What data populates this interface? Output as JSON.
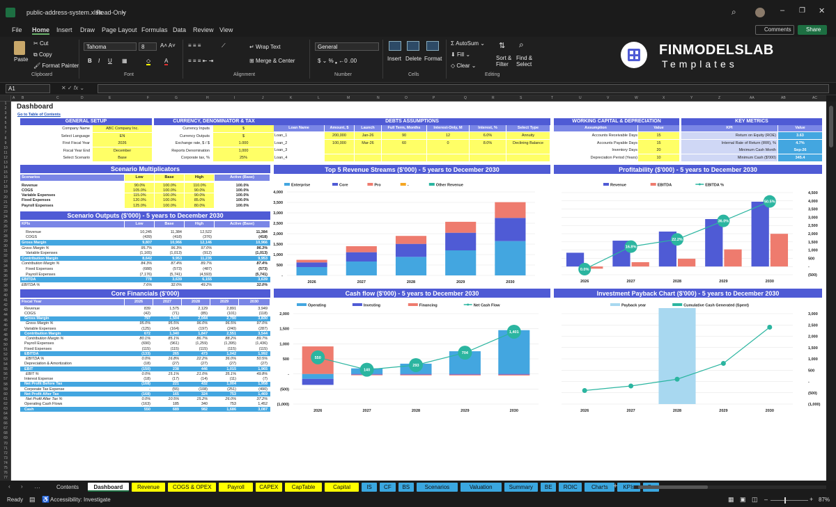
{
  "window": {
    "filename": "public-address-system.xlsx",
    "mode": "Read-Only"
  },
  "menu": [
    "File",
    "Home",
    "Insert",
    "Draw",
    "Page Layout",
    "Formulas",
    "Data",
    "Review",
    "View"
  ],
  "header_buttons": {
    "comments": "Comments",
    "share": "Share"
  },
  "ribbon": {
    "paste": "Paste",
    "cut": "Cut",
    "copy": "Copy",
    "format_painter": "Format Painter",
    "clipboard": "Clipboard",
    "font_name": "Tahoma",
    "font_size": "8",
    "font": "Font",
    "wrap_text": "Wrap Text",
    "merge_center": "Merge & Center",
    "alignment": "Alignment",
    "number_format": "General",
    "number": "Number",
    "insert": "Insert",
    "delete": "Delete",
    "format": "Format",
    "cells": "Cells",
    "autosum": "AutoSum",
    "fill": "Fill",
    "clear": "Clear",
    "sort_filter": "Sort &\nFilter",
    "find_select": "Find &\nSelect",
    "editing": "Editing"
  },
  "brand": {
    "name": "FINMODELSLAB",
    "tagline": "Templates"
  },
  "name_box": "A1",
  "columns": [
    "A",
    "B",
    "C",
    "D",
    "E",
    "F",
    "G",
    "H",
    "I",
    "J",
    "K",
    "L",
    "M",
    "N",
    "O",
    "P",
    "Q",
    "R",
    "S",
    "T",
    "U",
    "V",
    "W",
    "X",
    "Y",
    "Z",
    "AA",
    "AB",
    "AC"
  ],
  "sheet": {
    "title": "Dashboard",
    "toc_link": "Go to Table of Contents",
    "general_setup": {
      "title": "GENERAL SETUP",
      "rows": [
        [
          "Company Name",
          "ABC Company Inc."
        ],
        [
          "Select Language",
          "EN"
        ],
        [
          "First Fiscal Year",
          "2026"
        ],
        [
          "Fiscal Year End",
          "December"
        ],
        [
          "Select Scenario",
          "Base"
        ]
      ]
    },
    "currency": {
      "title": "CURRENCY, DENOMINATOR & TAX",
      "rows": [
        [
          "Currency Inputs",
          "$"
        ],
        [
          "Currency Outputs",
          "$"
        ],
        [
          "Exchange rate, $ / $",
          "1.000"
        ],
        [
          "Reports Denomination",
          "1,000"
        ],
        [
          "Corporate tax, %",
          "25%"
        ]
      ]
    },
    "debts": {
      "title": "DEBTS ASSUMPTIONS",
      "headers": [
        "Loan Name",
        "Amount, $",
        "Launch",
        "Full Term, Months",
        "Interest-Only, M",
        "Interest, %",
        "Select Type"
      ],
      "rows": [
        [
          "Loan_1",
          "200,000",
          "Jan-26",
          "90",
          "12",
          "6.0%",
          "Annuity"
        ],
        [
          "Loan_2",
          "100,000",
          "Mar-26",
          "60",
          "0",
          "8.0%",
          "Declining Balance"
        ],
        [
          "Loan_3",
          "",
          "",
          "",
          "",
          "",
          ""
        ],
        [
          "Loan_4",
          "",
          "",
          "",
          "",
          "",
          ""
        ]
      ]
    },
    "working_capital": {
      "title": "WORKING CAPITAL & DEPRECIATION",
      "headers": [
        "Assumption",
        "Value"
      ],
      "rows": [
        [
          "Accounts Receivable Days",
          "15"
        ],
        [
          "Accounts Payable Days",
          "15"
        ],
        [
          "Inventory Days",
          "20"
        ],
        [
          "Depreciation Period (Years)",
          "10"
        ]
      ]
    },
    "key_metrics": {
      "title": "KEY METRICS",
      "headers": [
        "KPI",
        "Value"
      ],
      "rows": [
        [
          "Return on Equity (ROE)",
          "3.63"
        ],
        [
          "Internal Rate of Return (IRR), %",
          "4.7%"
        ],
        [
          "Minimum Cash Month",
          "Sep-26"
        ],
        [
          "Minimum Cash ($'000)",
          "345.4"
        ]
      ]
    },
    "scenario_mult": {
      "title": "Scenario Multiplicators",
      "headers": [
        "Scenarios",
        "Low",
        "Base",
        "High",
        "Active (Base)"
      ],
      "rows": [
        [
          "Revenue",
          "90.0%",
          "100.0%",
          "110.0%",
          "100.0%"
        ],
        [
          "COGS",
          "105.0%",
          "100.0%",
          "90.0%",
          "100.0%"
        ],
        [
          "Variable Expenses",
          "115.0%",
          "100.0%",
          "90.0%",
          "100.0%"
        ],
        [
          "Fixed Expenses",
          "120.0%",
          "100.0%",
          "85.0%",
          "100.0%"
        ],
        [
          "Payroll Expenses",
          "125.0%",
          "100.0%",
          "80.0%",
          "100.0%"
        ]
      ]
    },
    "scenario_out": {
      "title": "Scenario Outputs ($'000) - 5 years to December 2030",
      "headers": [
        "KPIs",
        "Low",
        "Base",
        "High",
        "Active (Base)"
      ],
      "rows": [
        [
          "Revenue",
          "10,245",
          "11,384",
          "12,522",
          "11,384",
          "n"
        ],
        [
          "COGS",
          "(439)",
          "(418)",
          "(376)",
          "(418)",
          "n"
        ],
        [
          "Gross Margin",
          "9,807",
          "10,966",
          "12,146",
          "10,966",
          "h"
        ],
        [
          "Gross Margin %",
          "95.7%",
          "96.3%",
          "97.0%",
          "96.3%",
          "i"
        ],
        [
          "Variable Expenses",
          "(1,165)",
          "(1,013)",
          "(912)",
          "(1,013)",
          "n"
        ],
        [
          "Contribution Margin",
          "8,642",
          "9,953",
          "11,235",
          "9,953",
          "h"
        ],
        [
          "Contribution Margin %",
          "84.3%",
          "87.4%",
          "89.7%",
          "87.4%",
          "i"
        ],
        [
          "Fixed Expenses",
          "(688)",
          "(573)",
          "(487)",
          "(573)",
          "n"
        ],
        [
          "Payroll Expenses",
          "(7,176)",
          "(5,741)",
          "(4,593)",
          "(5,741)",
          "n"
        ],
        [
          "EBITDA",
          "778",
          "3,639",
          "6,155",
          "3,639",
          "h"
        ],
        [
          "EBITDA %",
          "7.6%",
          "32.0%",
          "49.2%",
          "32.0%",
          "i"
        ]
      ]
    },
    "core": {
      "title": "Core Financials ($'000)",
      "headers": [
        "Fiscal Year",
        "2026",
        "2027",
        "2028",
        "2029",
        "2030"
      ],
      "rows": [
        [
          "Revenue",
          "839",
          "1,575",
          "2,129",
          "2,891",
          "3,949",
          "n"
        ],
        [
          "COGS",
          "(42)",
          "(71)",
          "(85)",
          "(101)",
          "(118)",
          "n"
        ],
        [
          "Gross Margin",
          "797",
          "1,504",
          "2,044",
          "2,790",
          "3,830",
          "h"
        ],
        [
          "Gross Margin %",
          "95.0%",
          "95.5%",
          "96.0%",
          "96.5%",
          "97.0%",
          "i"
        ],
        [
          "Variable Expenses",
          "(125)",
          "(164)",
          "(197)",
          "(240)",
          "(287)",
          "n"
        ],
        [
          "Contribution Margin",
          "672",
          "1,340",
          "1,847",
          "2,551",
          "3,544",
          "h"
        ],
        [
          "Contribution Margin %",
          "80.1%",
          "85.1%",
          "86.7%",
          "88.2%",
          "89.7%",
          "i"
        ],
        [
          "Payroll Expenses",
          "(690)",
          "(961)",
          "(1,259)",
          "(1,395)",
          "(1,436)",
          "n"
        ],
        [
          "Fixed Expenses",
          "(115)",
          "(115)",
          "(115)",
          "(115)",
          "(115)",
          "n"
        ],
        [
          "EBITDA",
          "(133)",
          "265",
          "473",
          "1,042",
          "1,992",
          "h"
        ],
        [
          "EBITDA %",
          "0.0%",
          "16.8%",
          "22.2%",
          "36.0%",
          "50.5%",
          "i"
        ],
        [
          "Depreciation & Amortization",
          "(18)",
          "(27)",
          "(27)",
          "(27)",
          "(27)",
          "n"
        ],
        [
          "EBIT",
          "(150)",
          "238",
          "446",
          "1,015",
          "1,965",
          "h"
        ],
        [
          "EBIT %",
          "0.0%",
          "15.1%",
          "21.0%",
          "35.1%",
          "49.8%",
          "i"
        ],
        [
          "Interest Expense",
          "(18)",
          "(17)",
          "(14)",
          "(11)",
          "(7)",
          "n"
        ],
        [
          "Net Profit Before Tax",
          "(168)",
          "221",
          "432",
          "1,004",
          "1,958",
          "h"
        ],
        [
          "Corporate Tax Expense",
          "-",
          "(55)",
          "(108)",
          "(251)",
          "(490)",
          "n"
        ],
        [
          "Net Profit After Tax",
          "(168)",
          "165",
          "324",
          "753",
          "1,469",
          "h"
        ],
        [
          "Net Profit After Tax %",
          "0.0%",
          "10.5%",
          "15.2%",
          "26.0%",
          "37.2%",
          "i"
        ],
        [
          "Operating Cash Flows",
          "(163)",
          "185",
          "340",
          "753",
          "1,452",
          "n"
        ],
        [
          "Cash",
          "550",
          "689",
          "982",
          "1,686",
          "3,087",
          "h"
        ]
      ]
    }
  },
  "chart_data": [
    {
      "type": "bar",
      "title": "Top 5 Revenue Streams ($'000) - 5 years to December 2030",
      "categories": [
        "2026",
        "2027",
        "2028",
        "2029",
        "2030"
      ],
      "ylim": [
        0,
        4500
      ],
      "yticks": [
        "-",
        "500",
        "1,000",
        "1,500",
        "2,000",
        "2,500",
        "3,000",
        "3,500",
        "4,000"
      ],
      "series": [
        {
          "name": "Enterprise",
          "color": "#43a6e0",
          "values": [
            450,
            750,
            1000,
            1350,
            1850
          ]
        },
        {
          "name": "Core",
          "color": "#4f5bd5",
          "values": [
            250,
            500,
            700,
            950,
            1250
          ]
        },
        {
          "name": "Pro",
          "color": "#ee7b6e",
          "values": [
            140,
            325,
            429,
            591,
            849
          ]
        },
        {
          "name": "-",
          "color": "#f5a623",
          "values": [
            0,
            0,
            0,
            0,
            0
          ]
        },
        {
          "name": "Other Revenue",
          "color": "#2bb5a0",
          "values": [
            0,
            0,
            0,
            0,
            0
          ]
        }
      ]
    },
    {
      "type": "bar",
      "title": "Profitability ($'000) - 5 years to December 2030",
      "categories": [
        "2026",
        "2027",
        "2028",
        "2029",
        "2030"
      ],
      "ylim": [
        -500,
        4500
      ],
      "yticks": [
        "(500)",
        "-",
        "500",
        "1,000",
        "1,500",
        "2,000",
        "2,500",
        "3,000",
        "3,500",
        "4,000",
        "4,500"
      ],
      "ylabels_right": true,
      "series": [
        {
          "name": "Revenue",
          "color": "#4f5bd5",
          "values": [
            839,
            1575,
            2129,
            2891,
            3949
          ]
        },
        {
          "name": "EBITDA",
          "color": "#ee7b6e",
          "values": [
            -133,
            265,
            473,
            1042,
            1992
          ]
        },
        {
          "name": "EBITDA %",
          "color": "#2bb5a0",
          "line": true,
          "values": [
            0.0,
            16.8,
            22.2,
            36.0,
            50.5
          ],
          "labels": [
            "0.0%",
            "16.8%",
            "22.2%",
            "36.0%",
            "50.5%"
          ]
        }
      ]
    },
    {
      "type": "bar",
      "title": "Cash flow ($'000) - 5 years to December 2030",
      "categories": [
        "2026",
        "2027",
        "2028",
        "2029",
        "2030"
      ],
      "ylim": [
        -1000,
        2000
      ],
      "yticks": [
        "(1,000)",
        "(500)",
        "-",
        "500",
        "1,000",
        "1,500",
        "2,000"
      ],
      "series": [
        {
          "name": "Operating",
          "color": "#43a6e0",
          "values": [
            -163,
            185,
            340,
            753,
            1452
          ]
        },
        {
          "name": "Investing",
          "color": "#4f5bd5",
          "values": [
            -200,
            -25,
            -25,
            -25,
            -25
          ]
        },
        {
          "name": "Financing",
          "color": "#ee7b6e",
          "values": [
            913,
            -20,
            -22,
            -24,
            -26
          ]
        },
        {
          "name": "Net Cash Flow",
          "color": "#2bb5a0",
          "line": true,
          "values": [
            550,
            140,
            293,
            704,
            1401
          ],
          "labels": [
            "550",
            "140",
            "293",
            "704",
            "1,401"
          ]
        }
      ]
    },
    {
      "type": "line",
      "title": "Investment Payback Chart ($'000) - 5 years to December 2030",
      "categories": [
        "2026",
        "2027",
        "2028",
        "2029",
        "2030"
      ],
      "ylim": [
        -1000,
        3000
      ],
      "yticks": [
        "(1,000)",
        "(500)",
        "-",
        "500",
        "1,000",
        "1,500",
        "2,000",
        "2,500",
        "3,000"
      ],
      "ylabels_right": true,
      "series": [
        {
          "name": "Payback year",
          "color": "#a8d8f0",
          "band_index": 2
        },
        {
          "name": "Cumulative Cash Generated (Spent)",
          "color": "#2bb5a0",
          "values": [
            -400,
            -200,
            100,
            800,
            2400
          ]
        }
      ]
    }
  ],
  "tabs": [
    {
      "label": "Contents",
      "color": "#1b1b1b",
      "text": "#ddd"
    },
    {
      "label": "Dashboard",
      "color": "#ffffff",
      "text": "#111",
      "active": true
    },
    {
      "label": "Revenue",
      "color": "#ffff00"
    },
    {
      "label": "COGS & OPEX",
      "color": "#ffff00"
    },
    {
      "label": "Payroll",
      "color": "#ffff00"
    },
    {
      "label": "CAPEX",
      "color": "#ffff00"
    },
    {
      "label": "CapTable",
      "color": "#ffff00"
    },
    {
      "label": "Capital",
      "color": "#ffff00"
    },
    {
      "label": "IS",
      "color": "#3aa7e0"
    },
    {
      "label": "CF",
      "color": "#3aa7e0"
    },
    {
      "label": "BS",
      "color": "#3aa7e0"
    },
    {
      "label": "Scenarios",
      "color": "#3aa7e0"
    },
    {
      "label": "Valuation",
      "color": "#3aa7e0"
    },
    {
      "label": "Summary",
      "color": "#3aa7e0"
    },
    {
      "label": "BE",
      "color": "#3aa7e0"
    },
    {
      "label": "ROIC",
      "color": "#3aa7e0"
    },
    {
      "label": "Charts",
      "color": "#3aa7e0"
    },
    {
      "label": "KPIs",
      "color": "#3aa7e0"
    },
    {
      "label": "Se",
      "color": "#3aa7e0"
    }
  ],
  "status": {
    "ready": "Ready",
    "accessibility": "Accessibility: Investigate",
    "zoom": "87%"
  }
}
